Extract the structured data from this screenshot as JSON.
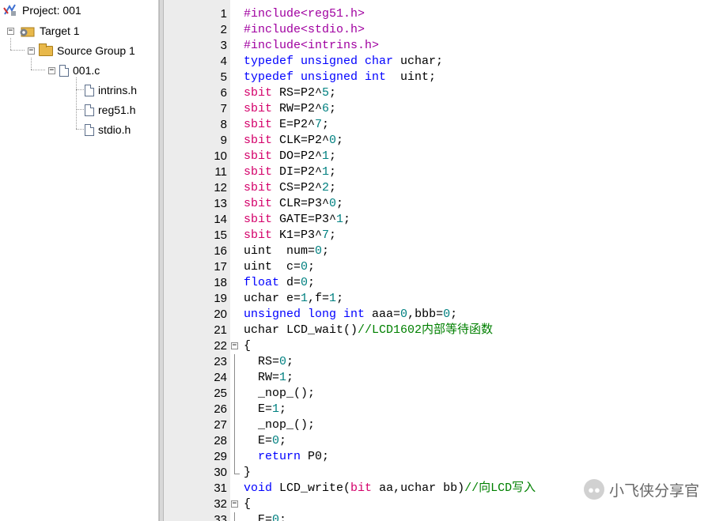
{
  "project_tree": {
    "project": "Project: 001",
    "target": "Target 1",
    "group": "Source Group 1",
    "file": "001.c",
    "headers": [
      "intrins.h",
      "reg51.h",
      "stdio.h"
    ]
  },
  "code_lines": [
    {
      "n": "1",
      "segs": [
        [
          "pp",
          "#include<reg51.h>"
        ]
      ]
    },
    {
      "n": "2",
      "segs": [
        [
          "pp",
          "#include<stdio.h>"
        ]
      ]
    },
    {
      "n": "3",
      "segs": [
        [
          "pp",
          "#include<intrins.h>"
        ]
      ]
    },
    {
      "n": "4",
      "segs": [
        [
          "kw",
          "typedef unsigned char"
        ],
        [
          "default",
          " uchar;"
        ]
      ]
    },
    {
      "n": "5",
      "segs": [
        [
          "kw",
          "typedef unsigned int"
        ],
        [
          "default",
          "  uint;"
        ]
      ]
    },
    {
      "n": "6",
      "segs": [
        [
          "kw2",
          "sbit"
        ],
        [
          "default",
          " RS=P2^"
        ],
        [
          "num",
          "5"
        ],
        [
          "default",
          ";"
        ]
      ]
    },
    {
      "n": "7",
      "segs": [
        [
          "kw2",
          "sbit"
        ],
        [
          "default",
          " RW=P2^"
        ],
        [
          "num",
          "6"
        ],
        [
          "default",
          ";"
        ]
      ]
    },
    {
      "n": "8",
      "segs": [
        [
          "kw2",
          "sbit"
        ],
        [
          "default",
          " E=P2^"
        ],
        [
          "num",
          "7"
        ],
        [
          "default",
          ";"
        ]
      ]
    },
    {
      "n": "9",
      "segs": [
        [
          "kw2",
          "sbit"
        ],
        [
          "default",
          " CLK=P2^"
        ],
        [
          "num",
          "0"
        ],
        [
          "default",
          ";"
        ]
      ]
    },
    {
      "n": "10",
      "segs": [
        [
          "kw2",
          "sbit"
        ],
        [
          "default",
          " DO=P2^"
        ],
        [
          "num",
          "1"
        ],
        [
          "default",
          ";"
        ]
      ]
    },
    {
      "n": "11",
      "segs": [
        [
          "kw2",
          "sbit"
        ],
        [
          "default",
          " DI=P2^"
        ],
        [
          "num",
          "1"
        ],
        [
          "default",
          ";"
        ]
      ]
    },
    {
      "n": "12",
      "segs": [
        [
          "kw2",
          "sbit"
        ],
        [
          "default",
          " CS=P2^"
        ],
        [
          "num",
          "2"
        ],
        [
          "default",
          ";"
        ]
      ]
    },
    {
      "n": "13",
      "segs": [
        [
          "kw2",
          "sbit"
        ],
        [
          "default",
          " CLR=P3^"
        ],
        [
          "num",
          "0"
        ],
        [
          "default",
          ";"
        ]
      ]
    },
    {
      "n": "14",
      "segs": [
        [
          "kw2",
          "sbit"
        ],
        [
          "default",
          " GATE=P3^"
        ],
        [
          "num",
          "1"
        ],
        [
          "default",
          ";"
        ]
      ]
    },
    {
      "n": "15",
      "segs": [
        [
          "kw2",
          "sbit"
        ],
        [
          "default",
          " K1=P3^"
        ],
        [
          "num",
          "7"
        ],
        [
          "default",
          ";"
        ]
      ]
    },
    {
      "n": "16",
      "segs": [
        [
          "default",
          "uint  num="
        ],
        [
          "num",
          "0"
        ],
        [
          "default",
          ";"
        ]
      ]
    },
    {
      "n": "17",
      "segs": [
        [
          "default",
          "uint  c="
        ],
        [
          "num",
          "0"
        ],
        [
          "default",
          ";"
        ]
      ]
    },
    {
      "n": "18",
      "segs": [
        [
          "kw",
          "float"
        ],
        [
          "default",
          " d="
        ],
        [
          "num",
          "0"
        ],
        [
          "default",
          ";"
        ]
      ]
    },
    {
      "n": "19",
      "segs": [
        [
          "default",
          "uchar e="
        ],
        [
          "num",
          "1"
        ],
        [
          "default",
          ",f="
        ],
        [
          "num",
          "1"
        ],
        [
          "default",
          ";"
        ]
      ]
    },
    {
      "n": "20",
      "segs": [
        [
          "kw",
          "unsigned long int"
        ],
        [
          "default",
          " aaa="
        ],
        [
          "num",
          "0"
        ],
        [
          "default",
          ",bbb="
        ],
        [
          "num",
          "0"
        ],
        [
          "default",
          ";"
        ]
      ]
    },
    {
      "n": "21",
      "segs": [
        [
          "default",
          "uchar LCD_wait()"
        ],
        [
          "cm",
          "//LCD1602内部等待函数"
        ]
      ]
    },
    {
      "n": "22",
      "fold": "open",
      "segs": [
        [
          "default",
          "{"
        ]
      ]
    },
    {
      "n": "23",
      "fold": "line",
      "segs": [
        [
          "default",
          "  RS="
        ],
        [
          "num",
          "0"
        ],
        [
          "default",
          ";"
        ]
      ]
    },
    {
      "n": "24",
      "fold": "line",
      "segs": [
        [
          "default",
          "  RW="
        ],
        [
          "num",
          "1"
        ],
        [
          "default",
          ";"
        ]
      ]
    },
    {
      "n": "25",
      "fold": "line",
      "segs": [
        [
          "default",
          "  _nop_();"
        ]
      ]
    },
    {
      "n": "26",
      "fold": "line",
      "segs": [
        [
          "default",
          "  E="
        ],
        [
          "num",
          "1"
        ],
        [
          "default",
          ";"
        ]
      ]
    },
    {
      "n": "27",
      "fold": "line",
      "segs": [
        [
          "default",
          "  _nop_();"
        ]
      ]
    },
    {
      "n": "28",
      "fold": "line",
      "segs": [
        [
          "default",
          "  E="
        ],
        [
          "num",
          "0"
        ],
        [
          "default",
          ";"
        ]
      ]
    },
    {
      "n": "29",
      "fold": "line",
      "segs": [
        [
          "default",
          "  "
        ],
        [
          "kw",
          "return"
        ],
        [
          "default",
          " P0;"
        ]
      ]
    },
    {
      "n": "30",
      "fold": "end",
      "segs": [
        [
          "default",
          "}"
        ]
      ]
    },
    {
      "n": "31",
      "segs": [
        [
          "kw",
          "void"
        ],
        [
          "default",
          " LCD_write("
        ],
        [
          "kw2",
          "bit"
        ],
        [
          "default",
          " aa,uchar bb)"
        ],
        [
          "cm",
          "//向LCD写入"
        ]
      ]
    },
    {
      "n": "32",
      "fold": "open",
      "segs": [
        [
          "default",
          "{"
        ]
      ]
    },
    {
      "n": "33",
      "fold": "line",
      "segs": [
        [
          "default",
          "  E="
        ],
        [
          "num",
          "0"
        ],
        [
          "default",
          ";"
        ]
      ]
    }
  ],
  "watermark": {
    "text": "小飞侠分享官",
    "icon": "wechat-icon"
  },
  "colors": {
    "preprocessor": "#a000a0",
    "keyword": "#0000ff",
    "sbit_keyword": "#d4006a",
    "number": "#008080",
    "comment": "#008000",
    "gutter": "#ececec"
  }
}
